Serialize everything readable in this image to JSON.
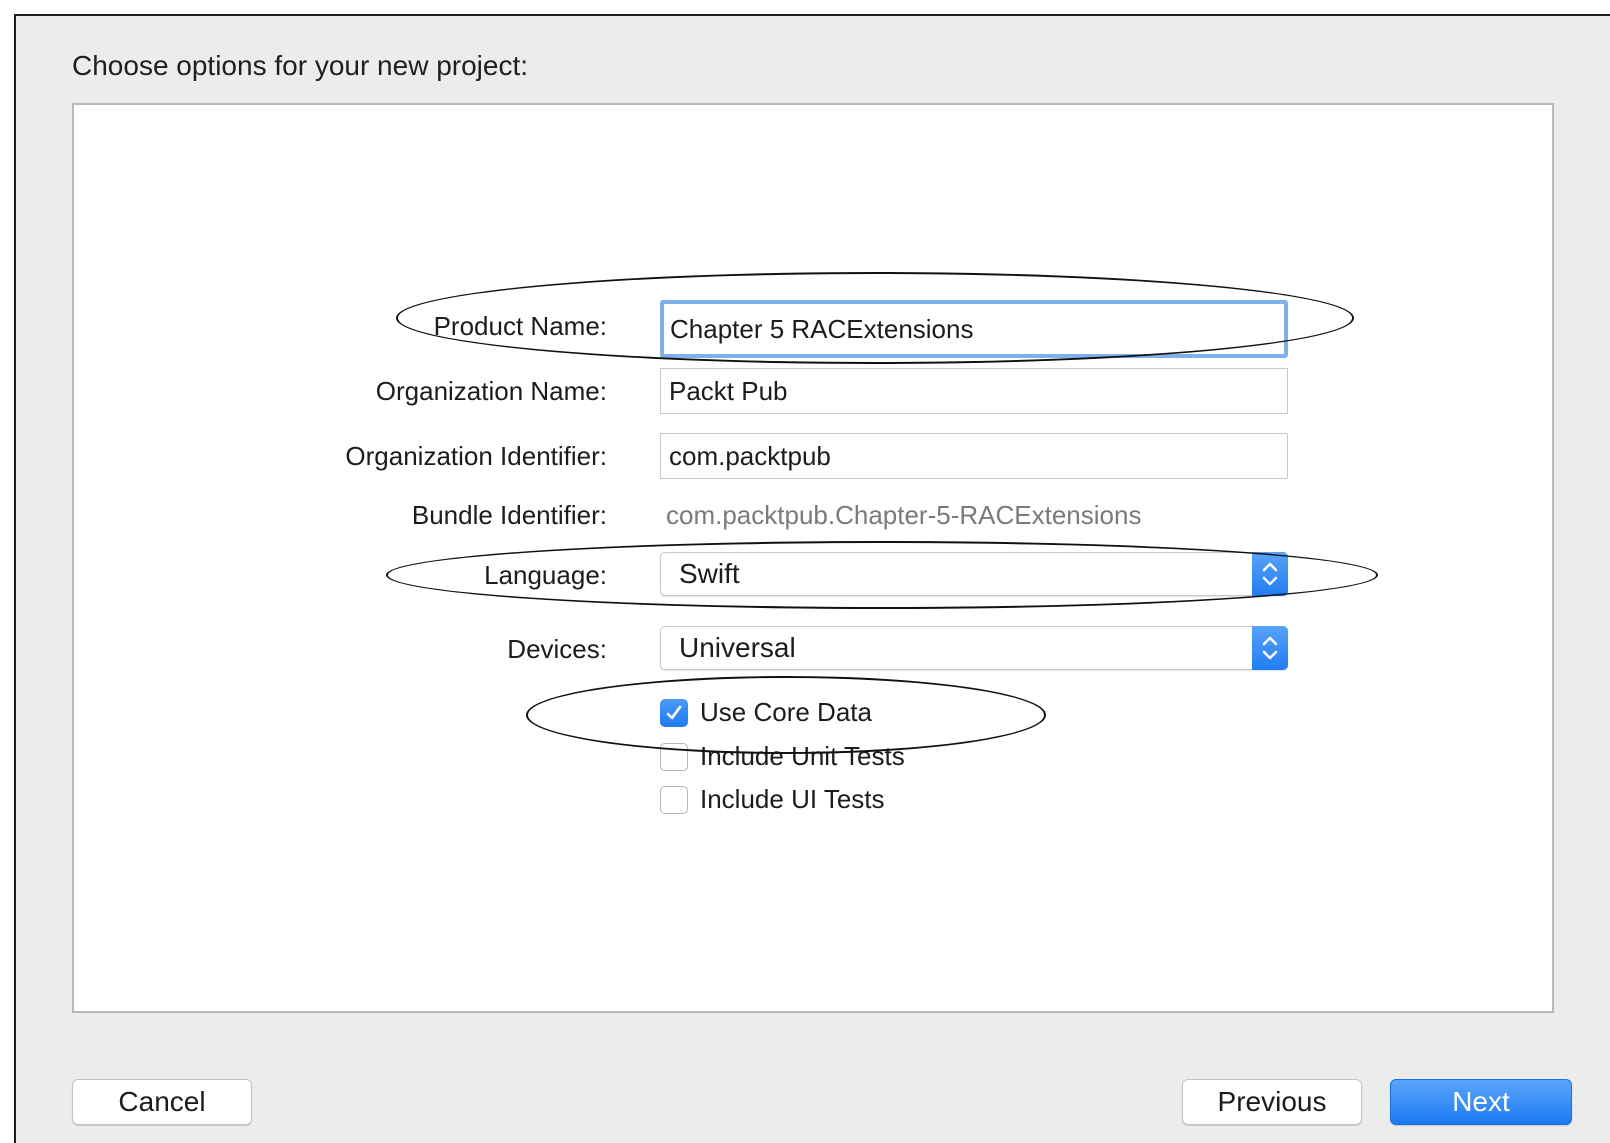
{
  "dialog": {
    "heading": "Choose options for your new project:"
  },
  "form": {
    "product_name": {
      "label": "Product Name:",
      "value": "Chapter 5 RACExtensions"
    },
    "organization_name": {
      "label": "Organization Name:",
      "value": "Packt Pub"
    },
    "organization_identifier": {
      "label": "Organization Identifier:",
      "value": "com.packtpub"
    },
    "bundle_identifier": {
      "label": "Bundle Identifier:",
      "value": "com.packtpub.Chapter-5-RACExtensions"
    },
    "language": {
      "label": "Language:",
      "selected": "Swift"
    },
    "devices": {
      "label": "Devices:",
      "selected": "Universal"
    },
    "checkboxes": [
      {
        "label": "Use Core Data",
        "checked": true
      },
      {
        "label": "Include Unit Tests",
        "checked": false
      },
      {
        "label": "Include UI Tests",
        "checked": false
      }
    ]
  },
  "buttons": {
    "cancel": "Cancel",
    "previous": "Previous",
    "next": "Next"
  },
  "icons": {
    "popup": "up-down-chevron-icon",
    "checkbox": "checkmark-icon"
  },
  "colors": {
    "accent": "#1f7cf2",
    "focus_ring": "#7fb0ec",
    "annotation": "#111111"
  }
}
